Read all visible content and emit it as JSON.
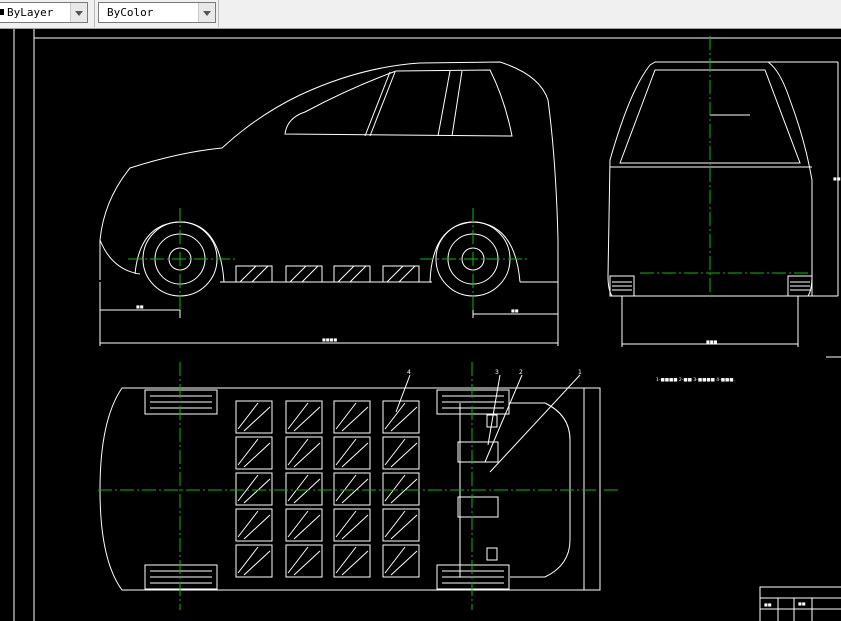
{
  "toolbar": {
    "linetype_value": "ByLayer",
    "color_value": "ByColor"
  },
  "drawing": {
    "dim_side_wheel_left": "■■",
    "dim_side_wheel_right": "■■",
    "dim_side_length": "■■■■",
    "dim_front_width": "■■■",
    "dim_front_height": "■■",
    "note_text": "1-■■■■ 2-■■ 3-■■■■ 4-■■■.",
    "callout_1": "1",
    "callout_2": "2",
    "callout_3": "3",
    "callout_4": "4",
    "title_block_cell_a": "■■",
    "title_block_cell_b": "■■"
  },
  "colors": {
    "line": "#ffffff",
    "centerline": "#00c000",
    "background": "#000000"
  }
}
